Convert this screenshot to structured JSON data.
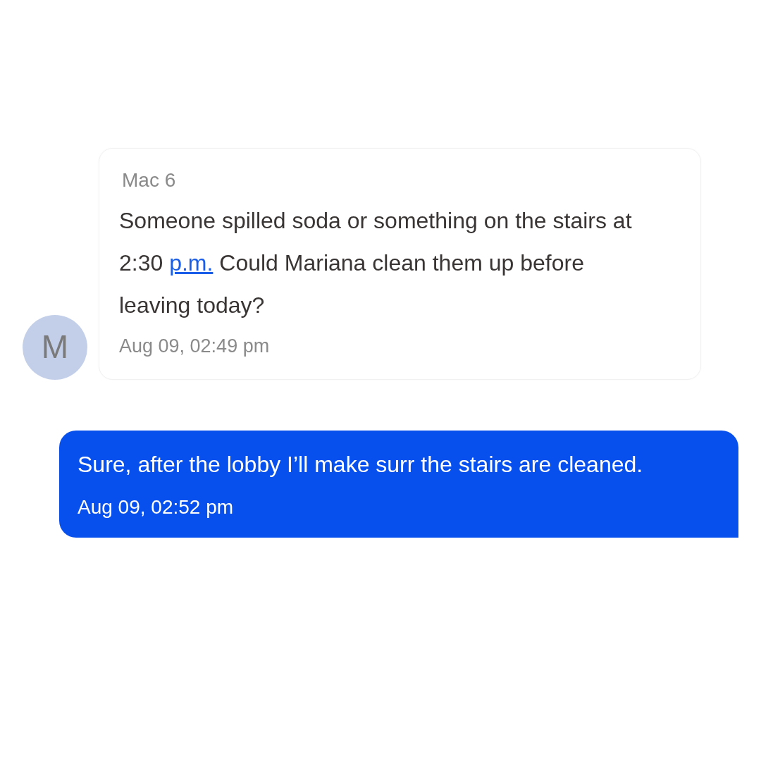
{
  "messages": [
    {
      "kind": "incoming",
      "avatar": "M",
      "sender": "Mac 6",
      "segments": [
        {
          "kind": "text",
          "text": "Someone spilled soda or something on the stairs at 2:30 "
        },
        {
          "kind": "link",
          "text": "p.m."
        },
        {
          "kind": "text",
          "text": " Could Mariana clean them up before leaving today?"
        }
      ],
      "time": "Aug 09, 02:49 pm"
    },
    {
      "kind": "outgoing",
      "segments": [
        {
          "kind": "text",
          "text": "Sure, after the lobby I’ll make surr the stairs are cleaned."
        }
      ],
      "time": "Aug 09, 02:52 pm"
    }
  ]
}
